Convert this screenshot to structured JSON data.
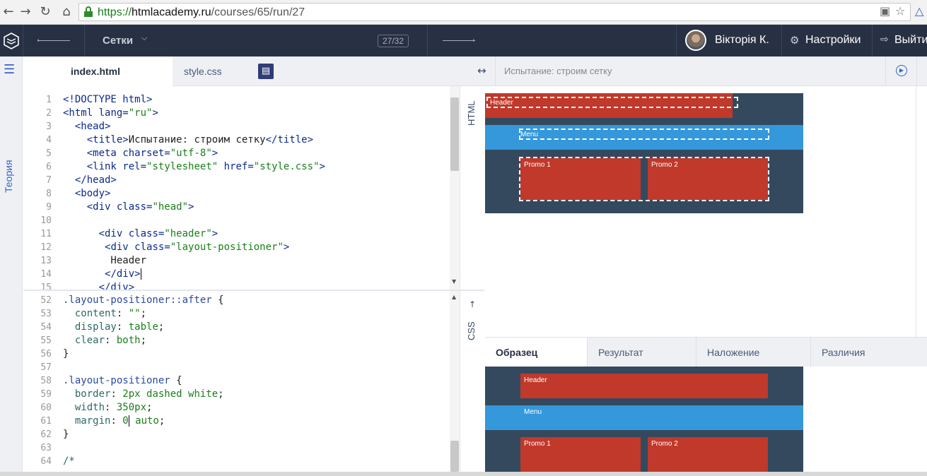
{
  "browser": {
    "url_scheme": "https://",
    "url_host": "htmlacademy.ru",
    "url_path": "/courses/65/run/27",
    "back_icon": "arrow-left-icon",
    "forward_icon": "arrow-right-icon",
    "reload_icon": "reload-icon",
    "home_icon": "home-icon"
  },
  "header": {
    "section": "Сетки",
    "counter": "27/32",
    "user_name": "Вікторія К.",
    "settings_label": "Настройки",
    "exit_label": "Выйти"
  },
  "rail": {
    "theory_label": "Теория"
  },
  "editor": {
    "tabs": [
      {
        "label": "index.html"
      },
      {
        "label": "style.css"
      }
    ],
    "html_vtab": "HTML",
    "css_vtab": "CSS",
    "css_vtab_arrow": "↑",
    "html_line_numbers": [
      "1",
      "2",
      "3",
      "4",
      "5",
      "6",
      "7",
      "8",
      "9",
      "10",
      "11",
      "12",
      "13",
      "14",
      "15"
    ],
    "css_line_numbers": [
      "52",
      "53",
      "54",
      "55",
      "56",
      "57",
      "58",
      "59",
      "60",
      "61",
      "62",
      "63",
      "64"
    ]
  },
  "preview": {
    "title": "Испытание: строим сетку",
    "header_label": "Header",
    "menu_label": "Menu",
    "promo1_label": "Promo 1",
    "promo2_label": "Promo 2"
  },
  "result_tabs": [
    {
      "label": "Образец"
    },
    {
      "label": "Результат"
    },
    {
      "label": "Наложение"
    },
    {
      "label": "Различия"
    }
  ],
  "colors": {
    "header_bg": "#283143",
    "accent": "#3a62c4",
    "stage": "#34495e",
    "red": "#c0392b",
    "blue": "#3498db"
  }
}
